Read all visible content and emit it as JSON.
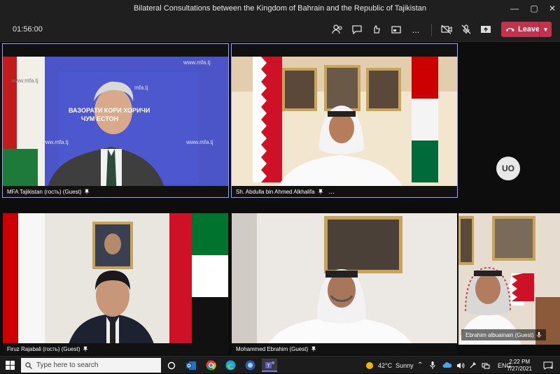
{
  "window": {
    "title": "Bilateral Consultations between the Kingdom of Bahrain and the Republic of Tajikistan",
    "minimize": "—",
    "maximize": "▢",
    "close": "✕"
  },
  "toolbar": {
    "timer": "01:56:00",
    "leave_label": "Leave",
    "more": "..."
  },
  "tiles": [
    {
      "name": "MFA Tajikistan (гость) (Guest)",
      "sign_line1": "ВАЗОРАТИ КОРИ ХОРИЧИ",
      "sign_line2": "ЧУМ    ЕСТОН",
      "web1": "www.mfa.tj",
      "web2": "www.mfa.tj",
      "web3": "www.mfa.tj",
      "web4": "mfa.tj",
      "web5": "www.mfa.tj"
    },
    {
      "name": "Sh. Abdulla bin Ahmed Alkhalifa",
      "more": "..."
    },
    {
      "name": "Firuz Rajabali (гость) (Guest)"
    },
    {
      "name": "Mohammed Ebrahim (Guest)"
    },
    {
      "name": "Ebrahim albuainain (Guest)"
    }
  ],
  "avatar": {
    "initials": "UO"
  },
  "taskbar": {
    "search_placeholder": "Type here to search",
    "temperature": "42°C",
    "weather": "Sunny",
    "language": "ENG",
    "time": "2:22 PM",
    "date": "7/27/2021",
    "notifications": "4"
  },
  "colors": {
    "accent": "#9aa0ff",
    "leave": "#c4314b",
    "bahrain_red": "#ce1126",
    "tj_green": "#006a3a",
    "tj_red": "#cc0000"
  }
}
